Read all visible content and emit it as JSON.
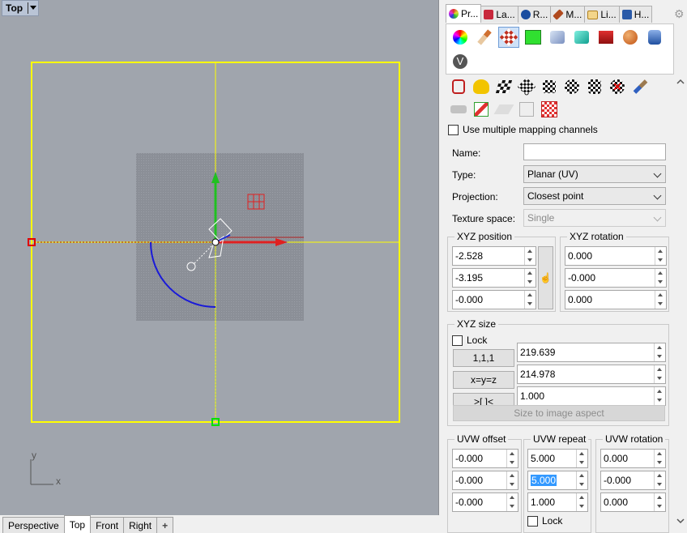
{
  "viewport": {
    "title": "Top",
    "axis_y": "y",
    "axis_x": "x",
    "tabs": [
      "Perspective",
      "Top",
      "Front",
      "Right"
    ],
    "active_tab": "Top",
    "add_tab_symbol": "+"
  },
  "panel": {
    "tabs": [
      {
        "label": "Pr...",
        "icon": "properties-icon",
        "color": "#e0306a"
      },
      {
        "label": "La...",
        "icon": "layers-icon",
        "color": "#c8283c"
      },
      {
        "label": "R...",
        "icon": "render-icon",
        "color": "#1a4da0"
      },
      {
        "label": "M...",
        "icon": "material-icon",
        "color": "#b04a1e"
      },
      {
        "label": "Li...",
        "icon": "libraries-icon",
        "color": "#d8a030"
      },
      {
        "label": "H...",
        "icon": "help-icon",
        "color": "#2a5aa8"
      }
    ],
    "property_icons": [
      "color-wheel-icon",
      "material-brush-icon",
      "texture-mapping-icon",
      "decal-icon",
      "object-icon",
      "shape-icon",
      "render-box-icon",
      "ball-icon",
      "layer-stack-icon",
      "vray-icon"
    ],
    "toolbar_row1": [
      "mapping-widget-icon",
      "duck-icon",
      "planar-map-icon",
      "box-map-icon",
      "cube-map-icon",
      "sphere-map-icon",
      "cylinder-map-icon",
      "remove-map-icon",
      "paintbrush-icon"
    ],
    "toolbar_row2": [
      "match-mapping-icon",
      "box-gizmo-icon",
      "surface-gizmo-icon",
      "uv-edit-icon",
      "checker-icon"
    ],
    "use_multiple_label": "Use multiple mapping channels",
    "name_label": "Name:",
    "name_value": "",
    "type_label": "Type:",
    "type_value": "Planar (UV)",
    "projection_label": "Projection:",
    "projection_value": "Closest point",
    "texture_space_label": "Texture space:",
    "texture_space_value": "Single",
    "xyz_position": {
      "label": "XYZ position",
      "values": [
        "-2.528",
        "-3.195",
        "-0.000"
      ]
    },
    "xyz_rotation": {
      "label": "XYZ rotation",
      "values": [
        "0.000",
        "-0.000",
        "0.000"
      ]
    },
    "xyz_size": {
      "label": "XYZ size",
      "lock_label": "Lock",
      "buttons": [
        "1,1,1",
        "x=y=z",
        ">[ ]<"
      ],
      "values": [
        "219.639",
        "214.978",
        "1.000"
      ],
      "size_to_image_label": "Size to image aspect"
    },
    "uvw_offset": {
      "label": "UVW offset",
      "values": [
        "-0.000",
        "-0.000",
        "-0.000"
      ]
    },
    "uvw_repeat": {
      "label": "UVW repeat",
      "values": [
        "5.000",
        "5.000",
        "1.000"
      ],
      "lock_label": "Lock"
    },
    "uvw_rotation": {
      "label": "UVW rotation",
      "values": [
        "0.000",
        "-0.000",
        "0.000"
      ]
    }
  }
}
